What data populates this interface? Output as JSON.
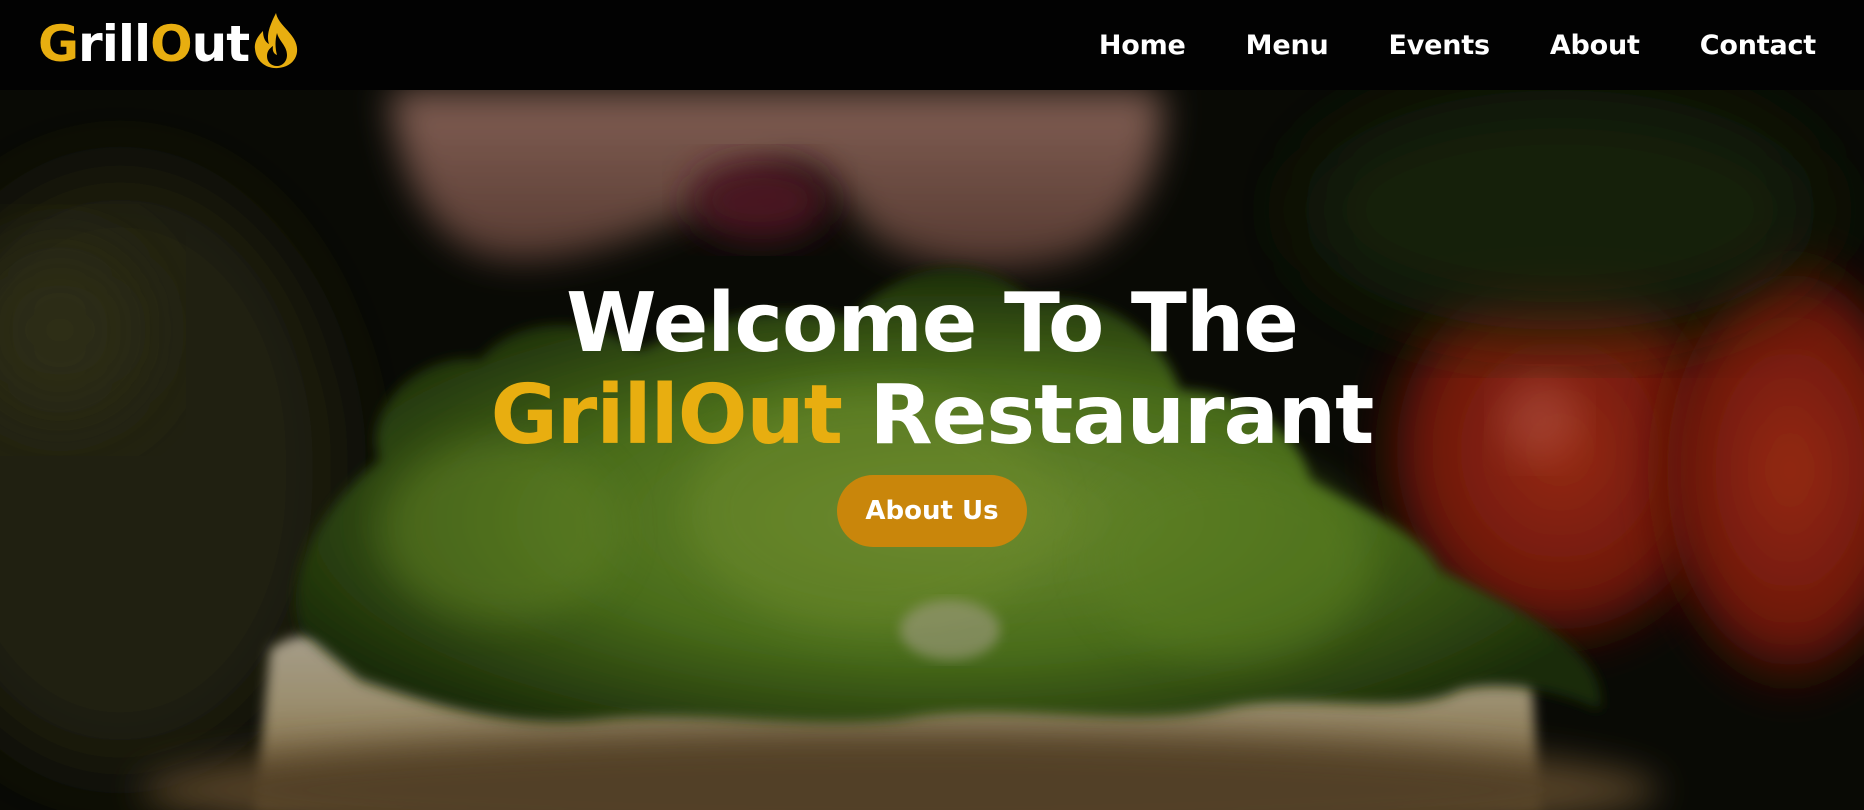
{
  "brand": {
    "logo_parts": [
      {
        "text": "G",
        "color": "#e8ae10"
      },
      {
        "text": "rill",
        "color": "#ffffff"
      },
      {
        "text": "O",
        "color": "#e8ae10"
      },
      {
        "text": "ut",
        "color": "#ffffff"
      }
    ],
    "logo_icon": "flame-icon",
    "accent_color": "#e8ae10"
  },
  "nav": {
    "items": [
      {
        "label": "Home"
      },
      {
        "label": "Menu"
      },
      {
        "label": "Events"
      },
      {
        "label": "About"
      },
      {
        "label": "Contact"
      }
    ]
  },
  "hero": {
    "title_line1": "Welcome To The",
    "title_accent": "GrillOut",
    "title_rest": " Restaurant",
    "cta_label": "About Us",
    "cta_color": "#c9860b",
    "background_subject": "burger-lettuce-photo"
  }
}
